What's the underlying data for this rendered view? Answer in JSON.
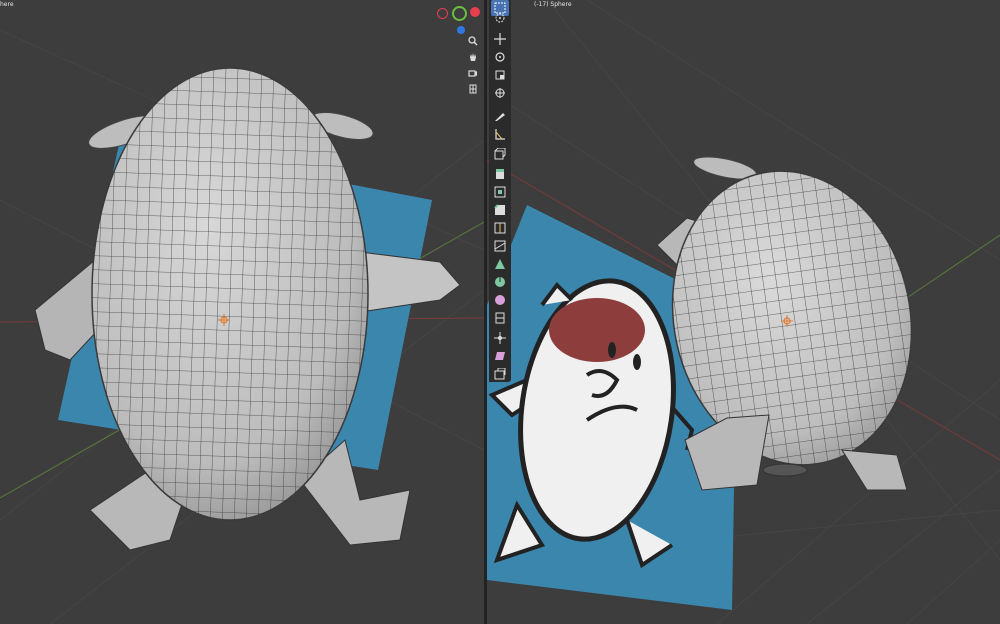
{
  "viewports": {
    "left": {
      "label": "here"
    },
    "right": {
      "label": "(-17) Sphere"
    }
  },
  "navigation_gizmo": {
    "axes": [
      {
        "name": "x",
        "color": "#e53f50"
      },
      {
        "name": "y",
        "color": "#6bbf3f"
      },
      {
        "name": "z",
        "color": "#2f77e0"
      }
    ],
    "buttons": [
      "zoom-icon",
      "hand-pan-icon",
      "camera-icon",
      "perspective-grid-icon"
    ]
  },
  "toolbar": {
    "tools": [
      {
        "name": "select-box-tool",
        "active": true
      },
      {
        "name": "cursor-tool",
        "active": false
      },
      {
        "name": "move-tool",
        "active": false
      },
      {
        "name": "rotate-tool",
        "active": false
      },
      {
        "name": "scale-tool",
        "active": false
      },
      {
        "name": "transform-tool",
        "active": false
      },
      {
        "name": "annotate-tool",
        "active": false
      },
      {
        "name": "measure-tool",
        "active": false
      },
      {
        "name": "add-cube-tool",
        "active": false
      },
      {
        "name": "extrude-tool",
        "active": false
      },
      {
        "name": "inset-tool",
        "active": false
      },
      {
        "name": "bevel-tool",
        "active": false
      },
      {
        "name": "loop-cut-tool",
        "active": false
      },
      {
        "name": "knife-tool",
        "active": false
      },
      {
        "name": "poly-build-tool",
        "active": false
      },
      {
        "name": "spin-tool",
        "active": false
      },
      {
        "name": "smooth-tool",
        "active": false
      },
      {
        "name": "edge-slide-tool",
        "active": false
      },
      {
        "name": "shrink-fatten-tool",
        "active": false
      },
      {
        "name": "shear-tool",
        "active": false
      },
      {
        "name": "rip-tool",
        "active": false
      }
    ]
  },
  "colors": {
    "viewport_bg": "#3d3d3d",
    "mesh": "#c9c9c9",
    "mesh_edge": "#2e2e2e",
    "reference_plane": "#3b86ad",
    "active_tool": "#4772b3",
    "cheek_red": "#8e3d3d"
  }
}
